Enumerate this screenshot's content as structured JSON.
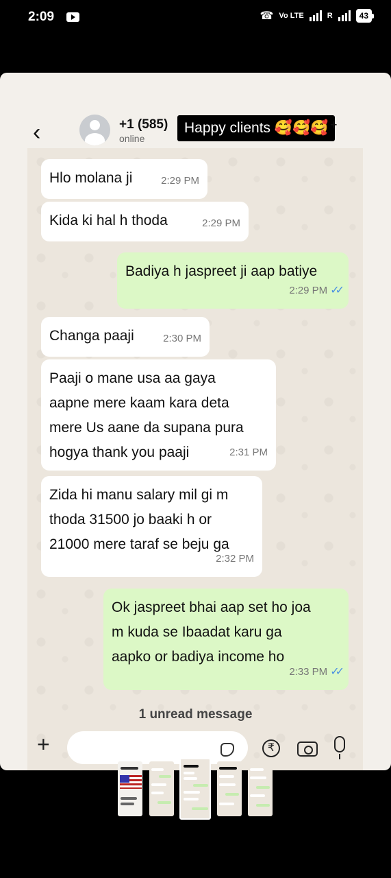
{
  "status_bar": {
    "time": "2:09",
    "network_label": "Vo LTE",
    "roaming": "R",
    "battery": "43"
  },
  "header": {
    "contact_name": "+1 (585)",
    "contact_status": "online",
    "caption": "Happy clients 🥰🥰🥰",
    "caption_plus": "+"
  },
  "messages": [
    {
      "dir": "in",
      "text": "Hlo molana ji",
      "time": "2:29 PM"
    },
    {
      "dir": "in",
      "text": "Kida ki hal h thoda",
      "time": "2:29 PM"
    },
    {
      "dir": "out",
      "text": "Badiya h jaspreet ji aap batiye",
      "time": "2:29 PM",
      "read": true
    },
    {
      "dir": "in",
      "text": "Changa paaji",
      "time": "2:30 PM"
    },
    {
      "dir": "in",
      "text": "Paaji o mane usa aa gaya\naapne mere kaam kara deta\nmere Us aane da supana pura\nhogya thank you paaji",
      "time": "2:31 PM"
    },
    {
      "dir": "in",
      "text": "Zida hi manu salary mil gi m\nthoda 31500 jo baaki h or\n21000 mere taraf se beju ga",
      "time": "2:32 PM"
    },
    {
      "dir": "out",
      "text": "Ok jaspreet bhai aap set ho joa\nm kuda se Ibaadat karu ga\naapko or badiya income ho",
      "time": "2:33 PM",
      "read": true
    }
  ],
  "unread_banner": "1 unread message",
  "input": {
    "plus": "+",
    "rupee": "₹",
    "icons": [
      "plus-icon",
      "sticker-icon",
      "rupee-icon",
      "camera-icon",
      "mic-icon"
    ]
  },
  "thumbnails_count": 5,
  "colors": {
    "incoming_bubble": "#ffffff",
    "outgoing_bubble": "#dcf8c6",
    "read_ticks": "#4a8fe2",
    "background": "#000000"
  }
}
